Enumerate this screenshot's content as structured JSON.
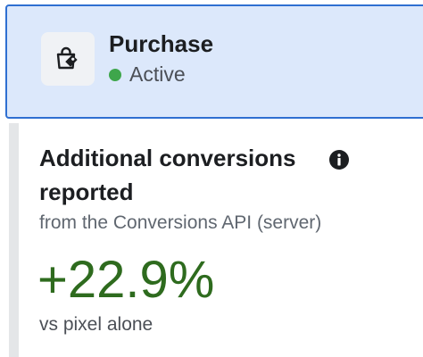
{
  "event": {
    "name": "Purchase",
    "status": "Active",
    "icon": "shopping-bag-icon",
    "status_color": "#3ea64b"
  },
  "metric": {
    "title": "Additional conversions reported",
    "source": "from the Conversions API (server)",
    "value": "+22.9%",
    "comparison": "vs pixel alone",
    "info_icon": "info-icon",
    "value_color": "#2e6b1e"
  },
  "colors": {
    "selected_background": "#dce8fb",
    "selected_border": "#2f6fd1"
  }
}
